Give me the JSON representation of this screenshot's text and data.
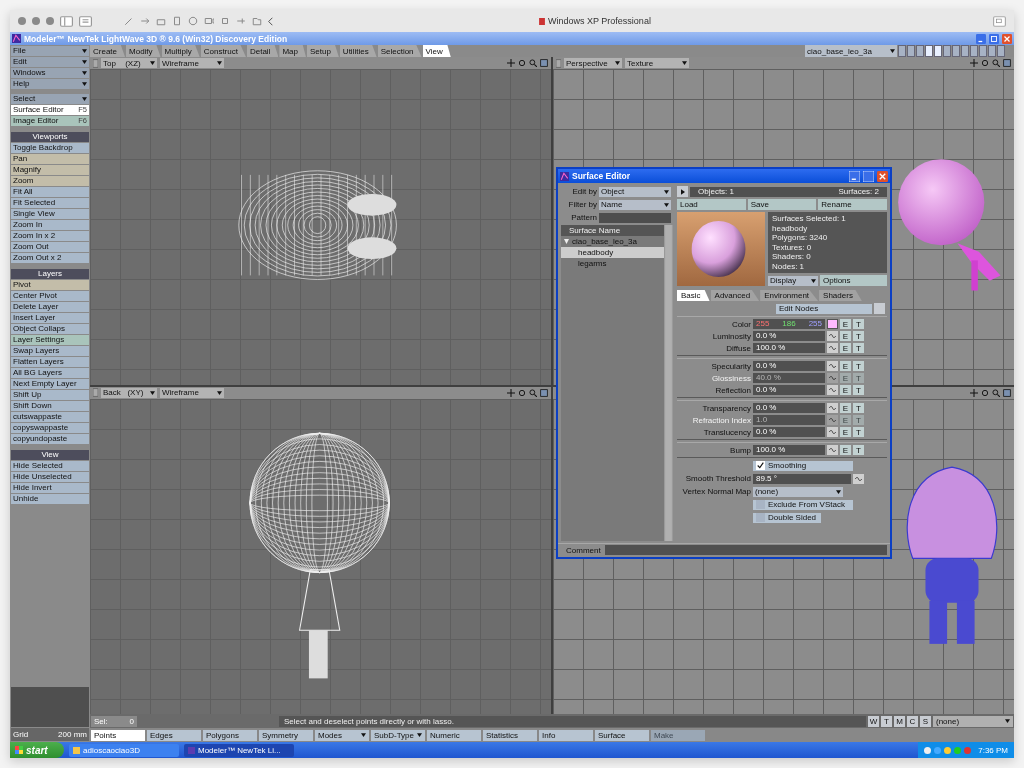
{
  "mac_window": {
    "title": "Windows XP Professional"
  },
  "app_window": {
    "title": "Modeler™ NewTek LightWave 3D ® 9.6  (Win32) Discovery Edition"
  },
  "sidebar": {
    "menus": [
      "File",
      "Edit",
      "Windows",
      "Help",
      "Select"
    ],
    "editors": [
      {
        "label": "Surface Editor",
        "shortcut": "F5",
        "selected": true
      },
      {
        "label": "Image Editor",
        "shortcut": "F6",
        "selected": false
      }
    ],
    "sections": [
      {
        "title": "Viewports",
        "items": [
          {
            "label": "Toggle Backdrop",
            "kind": "command"
          },
          {
            "label": "Pan",
            "kind": "tool"
          },
          {
            "label": "Magnify",
            "kind": "tool"
          },
          {
            "label": "Zoom",
            "kind": "tool"
          },
          {
            "label": "Fit All",
            "kind": "command"
          },
          {
            "label": "Fit Selected",
            "kind": "command"
          },
          {
            "label": "Single View",
            "kind": "command"
          },
          {
            "label": "Zoom In",
            "kind": "command"
          },
          {
            "label": "Zoom In x 2",
            "kind": "command"
          },
          {
            "label": "Zoom Out",
            "kind": "command"
          },
          {
            "label": "Zoom Out x 2",
            "kind": "command"
          }
        ]
      },
      {
        "title": "Layers",
        "items": [
          {
            "label": "Pivot",
            "kind": "tool"
          },
          {
            "label": "Center Pivot",
            "kind": "command"
          },
          {
            "label": "Delete Layer",
            "kind": "command"
          },
          {
            "label": "Insert Layer",
            "kind": "command"
          },
          {
            "label": "Object Collaps",
            "kind": "command"
          },
          {
            "label": "Layer Settings",
            "kind": "dialog"
          },
          {
            "label": "Swap Layers",
            "kind": "command"
          },
          {
            "label": "Flatten Layers",
            "kind": "command"
          },
          {
            "label": "All BG Layers",
            "kind": "command"
          },
          {
            "label": "Next Empty Layer",
            "kind": "command"
          },
          {
            "label": "Shift Up",
            "kind": "command"
          },
          {
            "label": "Shift Down",
            "kind": "command"
          },
          {
            "label": "cutswappaste",
            "kind": "command"
          },
          {
            "label": "copyswappaste",
            "kind": "command"
          },
          {
            "label": "copyundopaste",
            "kind": "command"
          }
        ]
      },
      {
        "title": "View",
        "items": [
          {
            "label": "Hide Selected",
            "kind": "command"
          },
          {
            "label": "Hide Unselected",
            "kind": "command"
          },
          {
            "label": "Hide Invert",
            "kind": "command"
          },
          {
            "label": "Unhide",
            "kind": "command"
          }
        ]
      }
    ],
    "grid": {
      "label": "Grid",
      "value": "200 mm"
    }
  },
  "toolbar_tabs": [
    {
      "label": "Create",
      "selected": false
    },
    {
      "label": "Modify",
      "selected": false
    },
    {
      "label": "Multiply",
      "selected": false
    },
    {
      "label": "Construct",
      "selected": false
    },
    {
      "label": "Detail",
      "selected": false
    },
    {
      "label": "Map",
      "selected": false
    },
    {
      "label": "Setup",
      "selected": false
    },
    {
      "label": "Utilities",
      "selected": false
    },
    {
      "label": "Selection",
      "selected": false
    },
    {
      "label": "View",
      "selected": true
    }
  ],
  "layer_select": {
    "value": "ciao_base_leo_3a"
  },
  "viewports": [
    {
      "view": "Top",
      "axes": "(XZ)",
      "mode": "Wireframe",
      "kind": "top-wireframe"
    },
    {
      "view": "Perspective",
      "mode": "Texture",
      "kind": "perspective-shaded"
    },
    {
      "view": "Back",
      "axes": "(XY)",
      "mode": "Wireframe",
      "kind": "back-wireframe"
    },
    {
      "kind": "perspective-wire-shaded"
    }
  ],
  "surface_editor": {
    "title": "Surface Editor",
    "edit_by": {
      "label": "Edit by",
      "value": "Object"
    },
    "filter_by": {
      "label": "Filter by",
      "value": "Name"
    },
    "pattern": {
      "label": "Pattern"
    },
    "list_header": "Surface Name",
    "surfaces": [
      {
        "label": "ciao_base_leo_3a",
        "selected": false,
        "expanded": true,
        "children": [
          {
            "label": "headbody",
            "selected": true
          },
          {
            "label": "legarms",
            "selected": false
          }
        ]
      }
    ],
    "objects": "Objects: 1",
    "surfaces_count": "Surfaces: 2",
    "actions": [
      "Load",
      "Save",
      "Rename"
    ],
    "info": [
      "Surfaces Selected: 1",
      "headbody",
      "Polygons: 3240",
      "Textures: 0",
      "Shaders: 0",
      "Nodes: 1"
    ],
    "display": "Display",
    "options": "Options",
    "tabs": [
      {
        "label": "Basic",
        "selected": true
      },
      {
        "label": "Advanced",
        "selected": false
      },
      {
        "label": "Environment",
        "selected": false
      },
      {
        "label": "Shaders",
        "selected": false
      }
    ],
    "edit_nodes": "Edit Nodes",
    "groups": [
      [
        {
          "kind": "color",
          "label": "Color",
          "red": "255",
          "green": "186",
          "blue": "255",
          "color": "#ffbaff",
          "buttons": [
            "E",
            "T"
          ]
        },
        {
          "kind": "numeric",
          "label": "Luminosity",
          "value": "0.0 %",
          "disabled": false,
          "buttons": [
            "E",
            "T"
          ]
        },
        {
          "kind": "numeric",
          "label": "Diffuse",
          "value": "100.0 %",
          "disabled": false,
          "buttons": [
            "E",
            "T"
          ]
        }
      ],
      [
        {
          "kind": "numeric",
          "label": "Specularity",
          "value": "0.0 %",
          "disabled": false,
          "buttons": [
            "E",
            "T"
          ]
        },
        {
          "kind": "numeric",
          "label": "Glossiness",
          "value": "40.0 %",
          "disabled": true,
          "buttons": [
            "E",
            "T"
          ]
        },
        {
          "kind": "numeric",
          "label": "Reflection",
          "value": "0.0 %",
          "disabled": false,
          "buttons": [
            "E",
            "T"
          ]
        }
      ],
      [
        {
          "kind": "numeric",
          "label": "Transparency",
          "value": "0.0 %",
          "disabled": false,
          "buttons": [
            "E",
            "T"
          ]
        },
        {
          "kind": "numeric",
          "label": "Refraction Index",
          "value": "1.0",
          "disabled": true,
          "buttons": [
            "E",
            "T"
          ]
        },
        {
          "kind": "numeric",
          "label": "Translucency",
          "value": "0.0 %",
          "disabled": false,
          "buttons": [
            "E",
            "T"
          ]
        }
      ],
      [
        {
          "kind": "numeric",
          "label": "Bump",
          "value": "100.0 %",
          "disabled": false,
          "buttons": [
            "E",
            "T"
          ]
        }
      ]
    ],
    "smoothing": {
      "label": "Smoothing",
      "checked": true
    },
    "smooth_threshold": {
      "label": "Smooth Threshold",
      "value": "89.5 °"
    },
    "vertex_normal_map": {
      "label": "Vertex Normal Map",
      "value": "(none)"
    },
    "toggles": [
      {
        "label": "Exclude From VStack",
        "checked": false
      },
      {
        "label": "Double Sided",
        "checked": false
      }
    ],
    "comment": {
      "label": "Comment"
    }
  },
  "status_bar": {
    "sel_label": "Sel:",
    "sel_value": "0",
    "message": "Select and deselect points directly or with lasso.",
    "view_buttons": [
      "W",
      "T",
      "M",
      "C",
      "S"
    ],
    "dropdown": "(none)"
  },
  "mode_bar": [
    {
      "label": "Points",
      "kind": "mode",
      "selected": true,
      "disabled": false
    },
    {
      "label": "Edges",
      "kind": "mode",
      "selected": false,
      "disabled": false
    },
    {
      "label": "Polygons",
      "kind": "mode",
      "selected": false,
      "disabled": false
    },
    {
      "label": "Symmetry",
      "kind": "button",
      "selected": false,
      "disabled": false
    },
    {
      "label": "Modes",
      "kind": "menu",
      "selected": false,
      "disabled": false
    },
    {
      "label": "SubD-Type",
      "kind": "menu",
      "selected": false,
      "disabled": false
    },
    {
      "label": "Numeric",
      "kind": "button",
      "selected": false,
      "disabled": false
    },
    {
      "label": "Statistics",
      "kind": "button",
      "selected": false,
      "disabled": false
    },
    {
      "label": "Info",
      "kind": "button",
      "selected": false,
      "disabled": false
    },
    {
      "label": "Surface",
      "kind": "button",
      "selected": false,
      "disabled": false
    },
    {
      "label": "Make",
      "kind": "button",
      "selected": false,
      "disabled": true
    }
  ],
  "taskbar": {
    "start": "start",
    "tasks": [
      {
        "label": "adioscaociao3D",
        "selected": false
      },
      {
        "label": "Modeler™ NewTek Li...",
        "selected": true
      }
    ],
    "clock": "7:36 PM"
  }
}
